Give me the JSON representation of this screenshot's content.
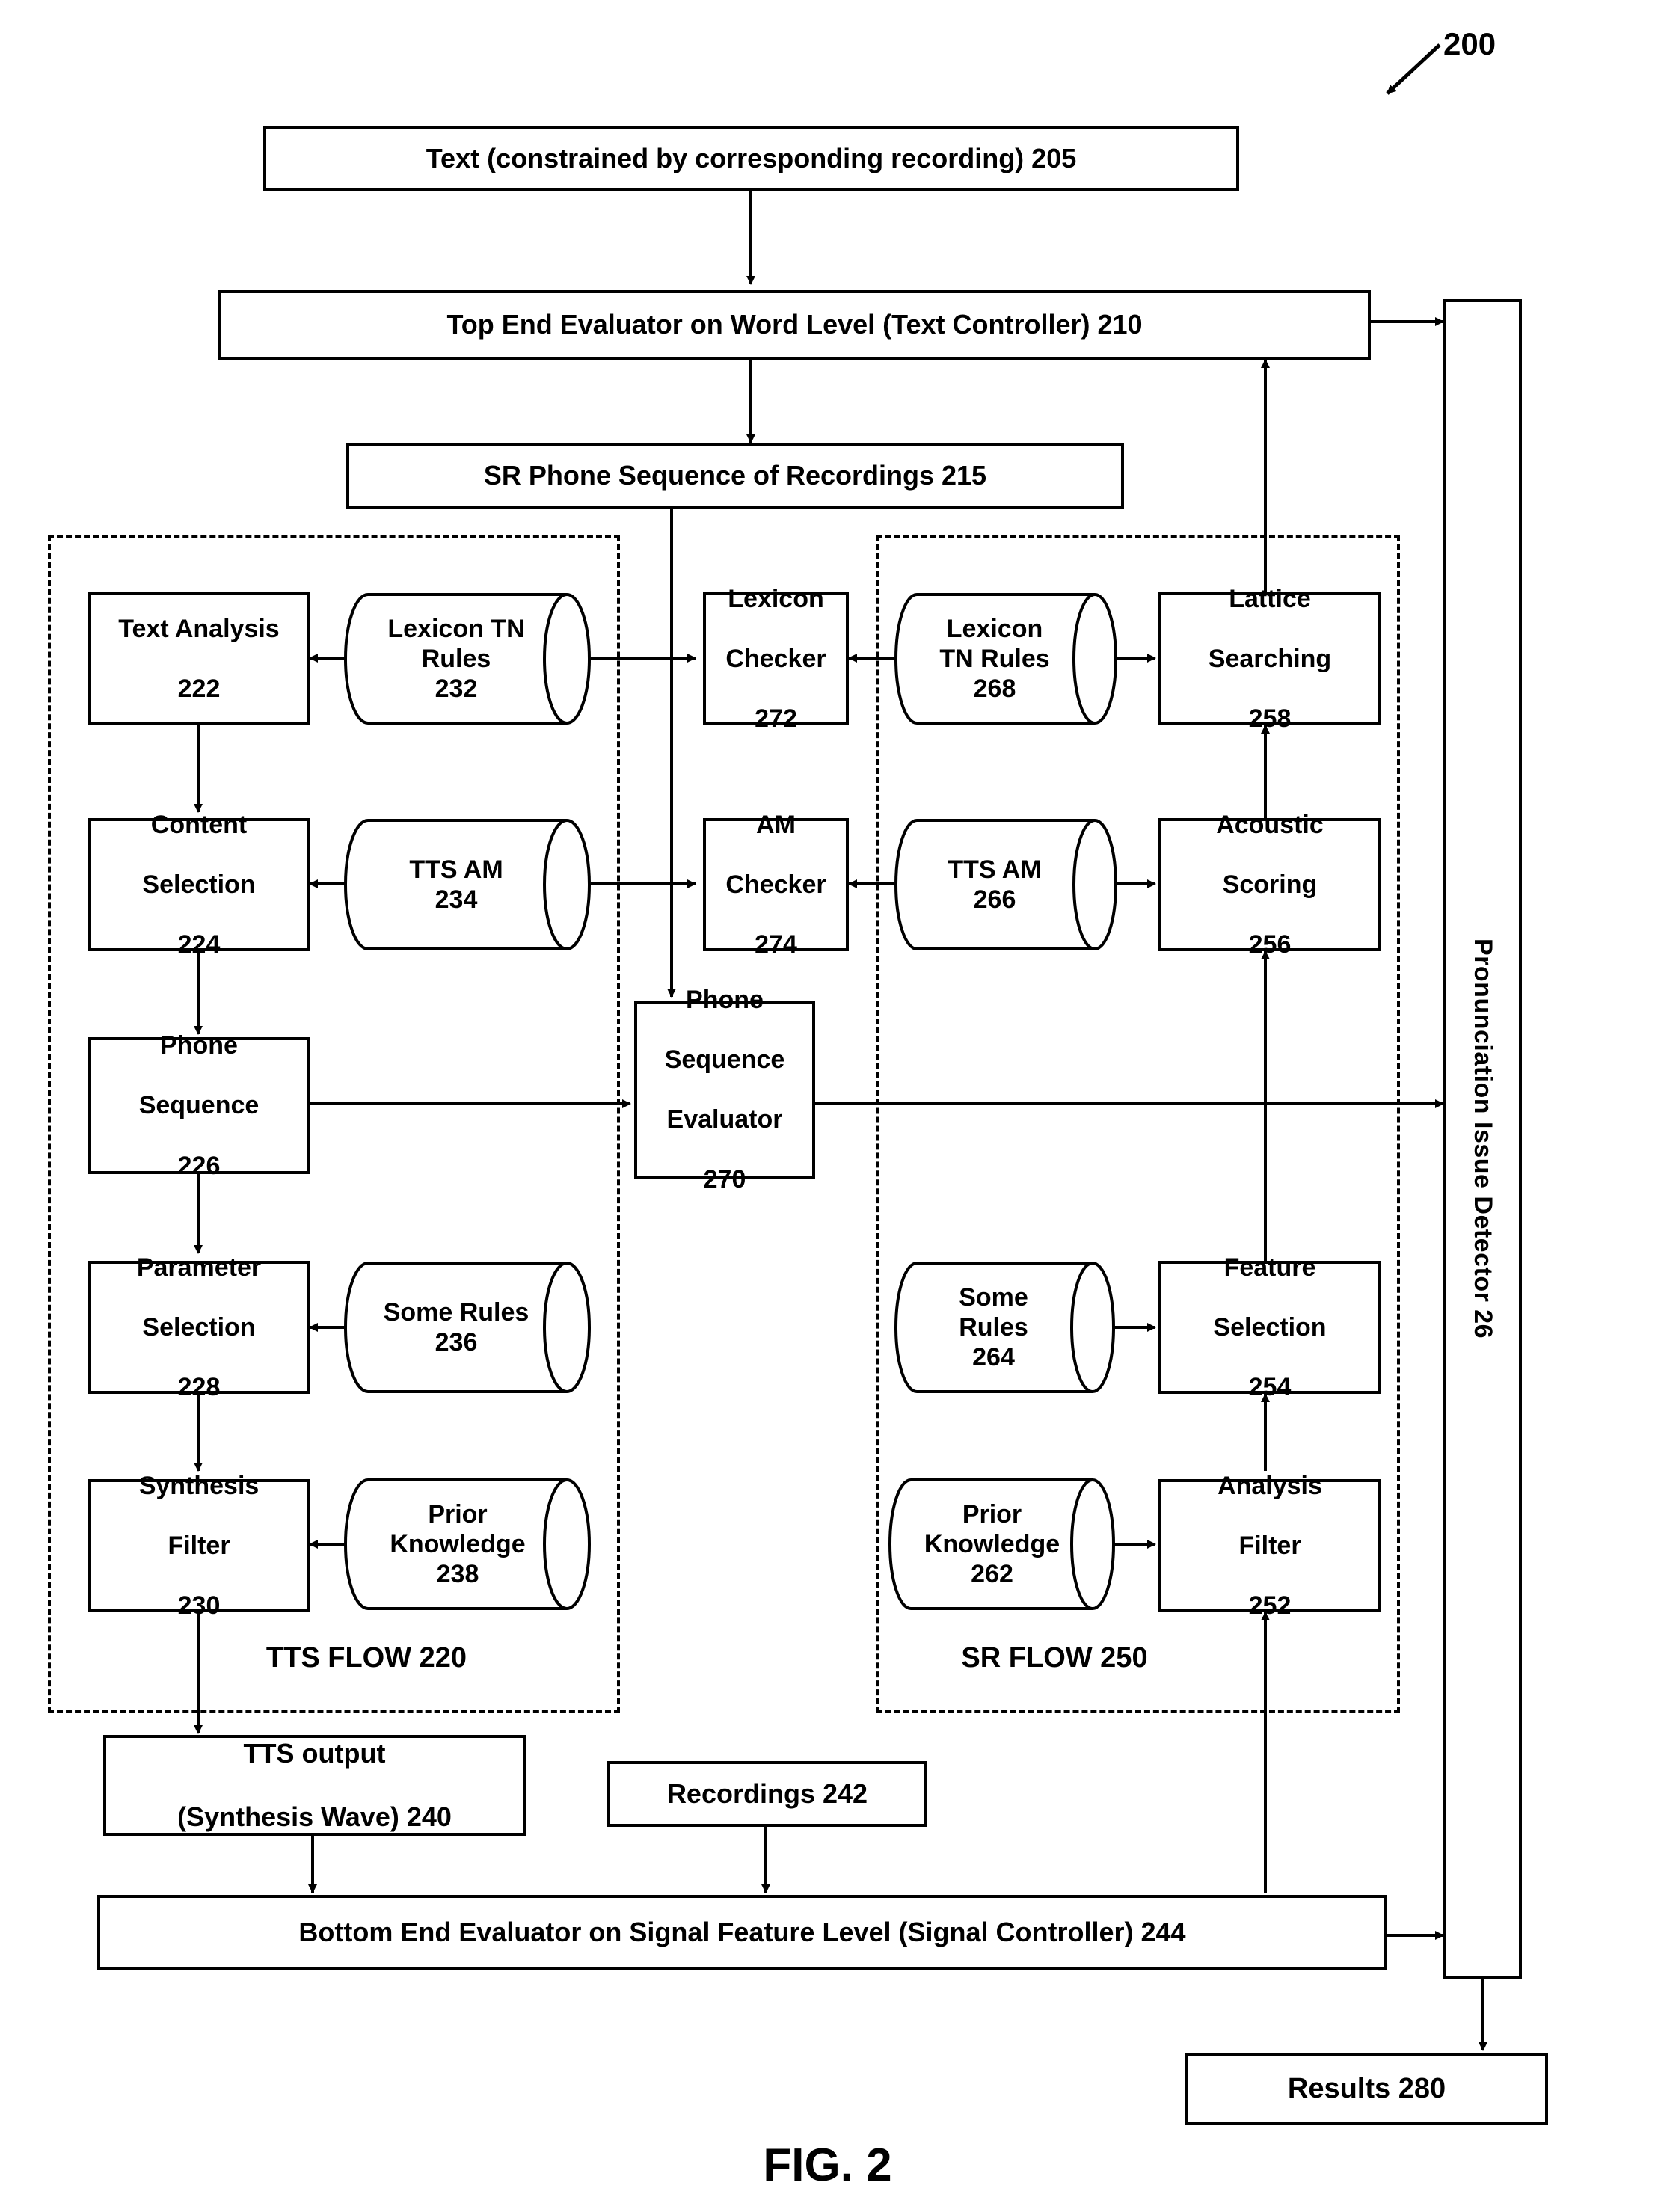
{
  "figure": {
    "caption": "FIG. 2",
    "reference_number": "200"
  },
  "nodes": {
    "text_input": "Text (constrained by corresponding recording) 205",
    "top_end_evaluator": "Top End Evaluator on Word Level (Text Controller) 210",
    "sr_phone_sequence": "SR Phone Sequence of Recordings 215",
    "text_analysis": [
      "Text Analysis",
      "222"
    ],
    "lexicon_tn_rules_232": [
      "Lexicon TN",
      "Rules",
      "232"
    ],
    "lexicon_checker": [
      "Lexicon",
      "Checker",
      "272"
    ],
    "lexicon_tn_rules_268": [
      "Lexicon",
      "TN Rules",
      "268"
    ],
    "lattice_searching": [
      "Lattice",
      "Searching",
      "258"
    ],
    "content_selection": [
      "Content",
      "Selection",
      "224"
    ],
    "tts_am_234": [
      "TTS AM",
      "234"
    ],
    "am_checker": [
      "AM",
      "Checker",
      "274"
    ],
    "tts_am_266": [
      "TTS AM",
      "266"
    ],
    "acoustic_scoring": [
      "Acoustic",
      "Scoring",
      "256"
    ],
    "phone_sequence": [
      "Phone",
      "Sequence",
      "226"
    ],
    "phone_sequence_evaluator": [
      "Phone",
      "Sequence",
      "Evaluator",
      "270"
    ],
    "parameter_selection": [
      "Parameter",
      "Selection",
      "228"
    ],
    "some_rules_236": [
      "Some Rules",
      "236"
    ],
    "some_rules_264": [
      "Some",
      "Rules",
      "264"
    ],
    "feature_selection": [
      "Feature",
      "Selection",
      "254"
    ],
    "synthesis_filter": [
      "Synthesis",
      "Filter",
      "230"
    ],
    "prior_knowledge_238": [
      "Prior",
      "Knowledge",
      "238"
    ],
    "prior_knowledge_262": [
      "Prior",
      "Knowledge",
      "262"
    ],
    "analysis_filter": [
      "Analysis",
      "Filter",
      "252"
    ],
    "tts_output": [
      "TTS output",
      "(Synthesis Wave) 240"
    ],
    "recordings": "Recordings 242",
    "bottom_end_evaluator": "Bottom End Evaluator on Signal Feature Level (Signal Controller) 244",
    "results": "Results 280",
    "pronunciation_issue_detector": "Pronunciation Issue Detector 26"
  },
  "groups": {
    "tts_flow_label": "TTS FLOW 220",
    "sr_flow_label": "SR FLOW 250"
  },
  "colors": {
    "stroke": "#000000",
    "background": "#ffffff"
  }
}
